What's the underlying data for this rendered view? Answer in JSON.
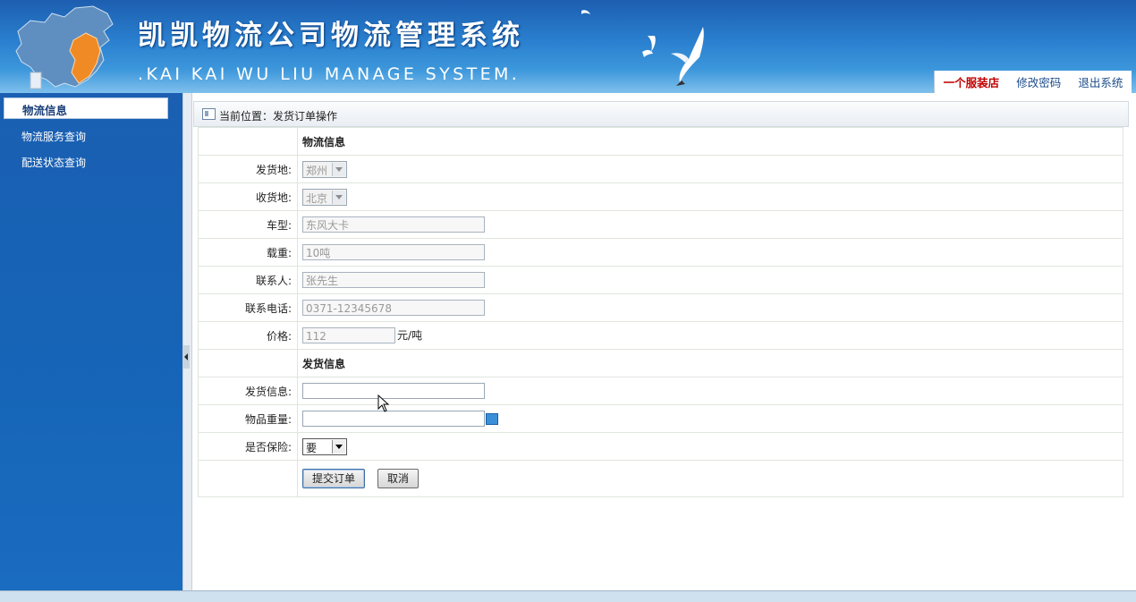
{
  "header": {
    "title": "凯凯物流公司物流管理系统",
    "subtitle": ".KAI KAI WU LIU MANAGE SYSTEM.",
    "nav": {
      "shop": "一个服装店",
      "change_password": "修改密码",
      "logout": "退出系统"
    }
  },
  "sidebar": {
    "heading": "物流信息",
    "items": [
      {
        "label": "物流服务查询"
      },
      {
        "label": "配送状态查询"
      }
    ]
  },
  "breadcrumb": {
    "text": "当前位置：发货订单操作"
  },
  "form": {
    "section_logistics": "物流信息",
    "origin": {
      "label": "发货地:",
      "value": "郑州"
    },
    "destination": {
      "label": "收货地:",
      "value": "北京"
    },
    "vehicle_type": {
      "label": "车型:",
      "value": "东风大卡"
    },
    "load": {
      "label": "载重:",
      "value": "10吨"
    },
    "contact": {
      "label": "联系人:",
      "value": "张先生"
    },
    "phone": {
      "label": "联系电话:",
      "value": "0371-12345678"
    },
    "price": {
      "label": "价格:",
      "value": "112",
      "unit": "元/吨"
    },
    "section_shipping": "发货信息",
    "shipping_info": {
      "label": "发货信息:",
      "value": ""
    },
    "item_weight": {
      "label": "物品重量:",
      "value": ""
    },
    "insurance": {
      "label": "是否保险:",
      "value": "要"
    },
    "submit_label": "提交订单",
    "cancel_label": "取消"
  },
  "colors": {
    "header_blue": "#2a80cf",
    "sidebar_blue": "#1665b8",
    "shop_red": "#c00000",
    "link_blue": "#1c4c8c"
  }
}
